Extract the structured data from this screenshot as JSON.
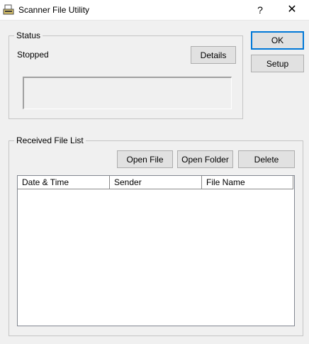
{
  "window": {
    "title": "Scanner File Utility",
    "help_label": "?",
    "close_label": "✕"
  },
  "status": {
    "group_label": "Status",
    "state_text": "Stopped",
    "details_label": "Details"
  },
  "side_buttons": {
    "ok_label": "OK",
    "setup_label": "Setup"
  },
  "received": {
    "group_label": "Received File List",
    "open_file_label": "Open File",
    "open_folder_label": "Open Folder",
    "delete_label": "Delete",
    "columns": [
      "Date & Time",
      "Sender",
      "File Name"
    ],
    "rows": []
  },
  "colors": {
    "window_bg": "#f0f0f0",
    "default_button_border": "#0078d7"
  },
  "icons": {
    "app_icon": "scanner-icon"
  }
}
